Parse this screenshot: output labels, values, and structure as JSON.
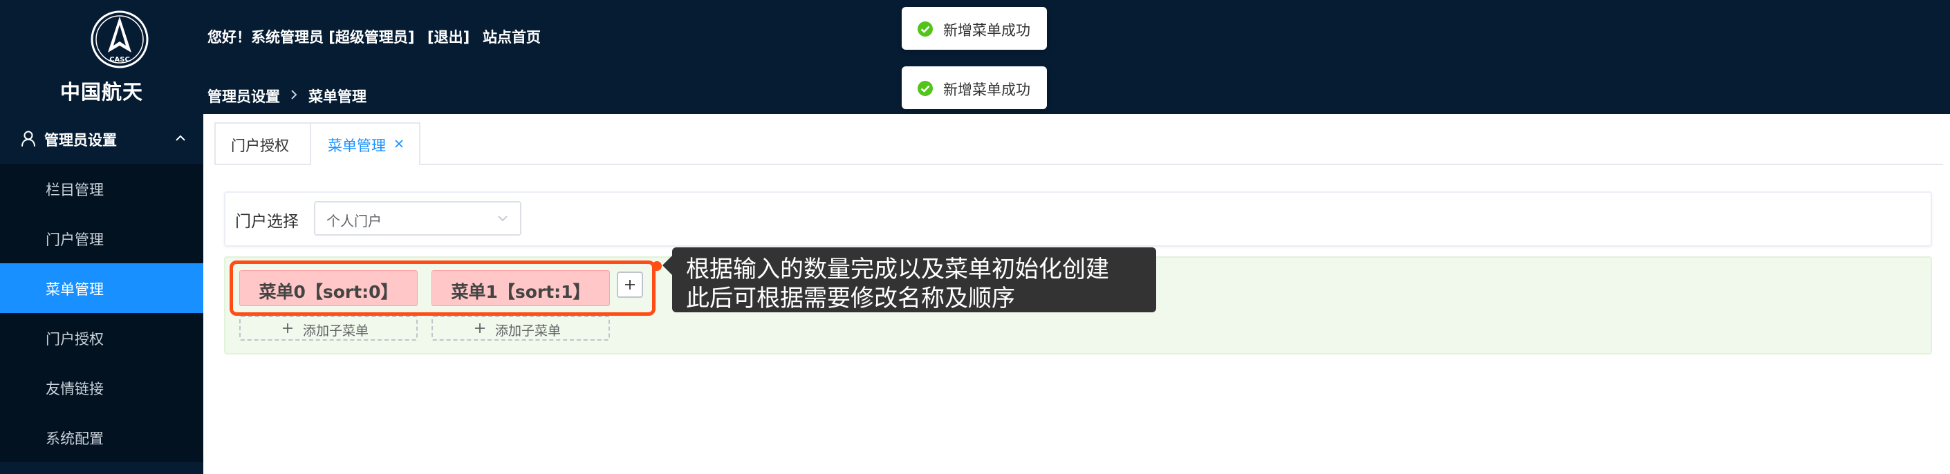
{
  "brand": {
    "emblem_text": "CASC",
    "name": "中国航天"
  },
  "header": {
    "greeting": "您好！系统管理员 [超级管理员]",
    "logout": "[退出]",
    "home": "站点首页"
  },
  "breadcrumb": {
    "items": [
      "管理员设置",
      "菜单管理"
    ]
  },
  "toasts": [
    {
      "text": "新增菜单成功"
    },
    {
      "text": "新增菜单成功"
    }
  ],
  "sidebar": {
    "group_label": "管理员设置",
    "items": [
      {
        "label": "栏目管理",
        "active": false
      },
      {
        "label": "门户管理",
        "active": false
      },
      {
        "label": "菜单管理",
        "active": true
      },
      {
        "label": "门户授权",
        "active": false
      },
      {
        "label": "友情链接",
        "active": false
      },
      {
        "label": "系统配置",
        "active": false
      }
    ]
  },
  "tabs": [
    {
      "label": "门户授权",
      "active": false
    },
    {
      "label": "菜单管理",
      "active": true
    }
  ],
  "portal_select": {
    "label": "门户选择",
    "value": "个人门户"
  },
  "menus": [
    {
      "label": "菜单0【sort:0】",
      "sub_add_label": "添加子菜单"
    },
    {
      "label": "菜单1【sort:1】",
      "sub_add_label": "添加子菜单"
    }
  ],
  "callout": {
    "line1": "根据输入的数量完成以及菜单初始化创建",
    "line2": "此后可根据需要修改名称及顺序"
  },
  "colors": {
    "header_bg": "#061c33",
    "active_blue": "#1890ff",
    "menu_chip": "#ffc7c7",
    "highlight": "#ff4d15",
    "success": "#52c41a"
  }
}
